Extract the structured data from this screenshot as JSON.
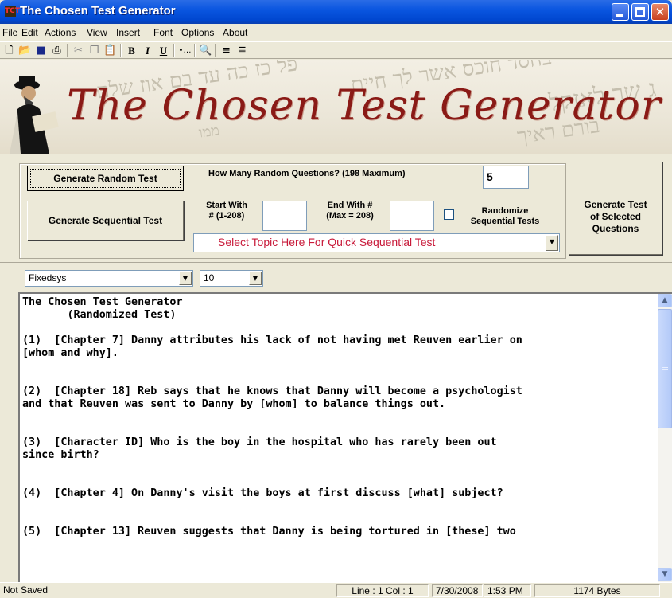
{
  "window": {
    "title": "The Chosen Test Generator"
  },
  "menu": [
    "File",
    "Edit",
    "Actions",
    "View",
    "Insert",
    "Font",
    "Options",
    "About"
  ],
  "toolbar": {
    "bold": "B",
    "italic": "I",
    "underline": "U"
  },
  "banner": {
    "title": "The Chosen Test Generator"
  },
  "controls": {
    "generate_random": "Generate Random Test",
    "generate_sequential": "Generate Sequential Test",
    "how_many_label": "How Many Random Questions? (198 Maximum)",
    "how_many_value": "5",
    "start_with_label_1": "Start With",
    "start_with_label_2": "# (1-208)",
    "start_with_value": "",
    "end_with_label_1": "End With #",
    "end_with_label_2": "(Max = 208)",
    "end_with_value": "",
    "randomize_label_1": "Randomize",
    "randomize_label_2": "Sequential Tests",
    "topic_select": "Select Topic Here For Quick Sequential Test",
    "generate_selected_1": "Generate Test",
    "generate_selected_2": "of Selected",
    "generate_selected_3": "Questions"
  },
  "font_bar": {
    "font_name": "Fixedsys",
    "font_size": "10"
  },
  "editor": {
    "text": "The Chosen Test Generator\n       (Randomized Test)\n\n(1)  [Chapter 7] Danny attributes his lack of not having met Reuven earlier on\n[whom and why].\n\n\n(2)  [Chapter 18] Reb says that he knows that Danny will become a psychologist\nand that Reuven was sent to Danny by [whom] to balance things out.\n\n\n(3)  [Character ID] Who is the boy in the hospital who has rarely been out\nsince birth?\n\n\n(4)  [Chapter 4] On Danny's visit the boys at first discuss [what] subject?\n\n\n(5)  [Chapter 13] Reuven suggests that Danny is being tortured in [these] two"
  },
  "status": {
    "saved": "Not Saved",
    "position": "Line : 1   Col : 1",
    "date": "7/30/2008",
    "time": "1:53 PM",
    "size": "1174 Bytes"
  }
}
